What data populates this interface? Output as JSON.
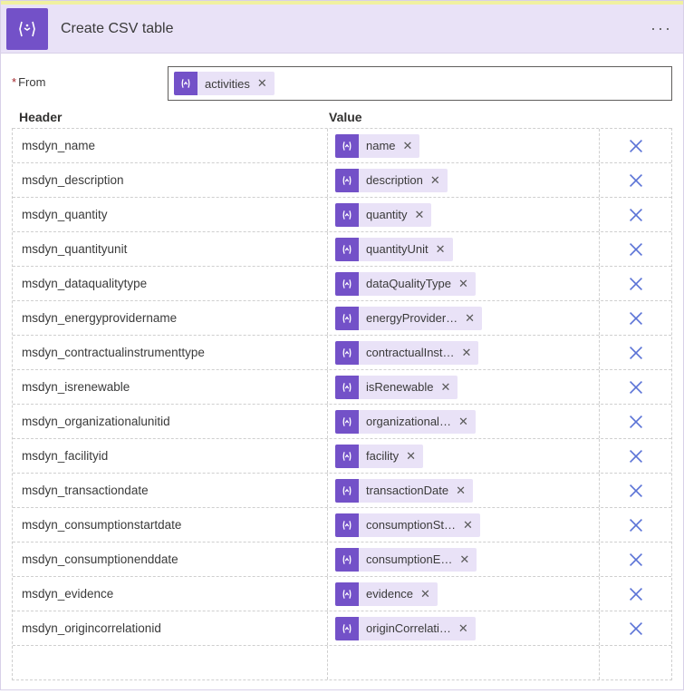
{
  "card": {
    "title": "Create CSV table"
  },
  "from": {
    "label": "From",
    "required_marker": "*",
    "token": "activities"
  },
  "columns": {
    "header_label": "Header",
    "value_label": "Value"
  },
  "rows": [
    {
      "header": "msdyn_name",
      "value": "name"
    },
    {
      "header": "msdyn_description",
      "value": "description"
    },
    {
      "header": "msdyn_quantity",
      "value": "quantity"
    },
    {
      "header": "msdyn_quantityunit",
      "value": "quantityUnit"
    },
    {
      "header": "msdyn_dataqualitytype",
      "value": "dataQualityType"
    },
    {
      "header": "msdyn_energyprovidername",
      "value": "energyProvider…"
    },
    {
      "header": "msdyn_contractualinstrumenttype",
      "value": "contractualInst…"
    },
    {
      "header": "msdyn_isrenewable",
      "value": "isRenewable"
    },
    {
      "header": "msdyn_organizationalunitid",
      "value": "organizational…"
    },
    {
      "header": "msdyn_facilityid",
      "value": "facility"
    },
    {
      "header": "msdyn_transactiondate",
      "value": "transactionDate"
    },
    {
      "header": "msdyn_consumptionstartdate",
      "value": "consumptionSt…"
    },
    {
      "header": "msdyn_consumptionenddate",
      "value": "consumptionE…"
    },
    {
      "header": "msdyn_evidence",
      "value": "evidence"
    },
    {
      "header": "msdyn_origincorrelationid",
      "value": "originCorrelati…"
    }
  ]
}
